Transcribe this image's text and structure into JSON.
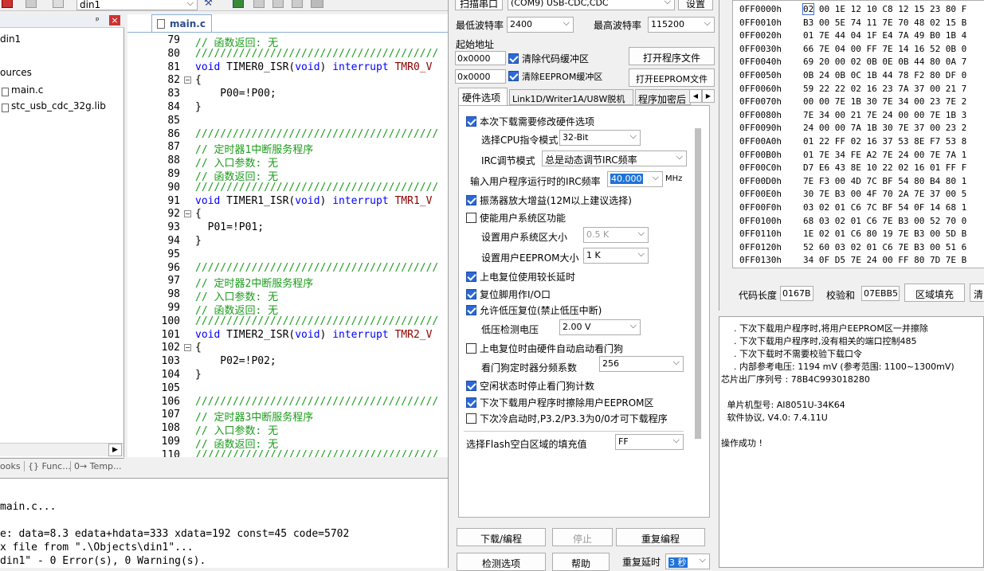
{
  "toolbar": {
    "target_select": "din1"
  },
  "project": {
    "header_pin": "ᵖ",
    "header_close": "×",
    "items": [
      {
        "label": "din1"
      },
      {
        "label": "ources"
      },
      {
        "label": "main.c"
      },
      {
        "label": "stc_usb_cdc_32g.lib"
      }
    ],
    "bottom_tabs": [
      {
        "label": "ooks"
      },
      {
        "label": "{} Func..."
      },
      {
        "label": "0→ Temp..."
      }
    ]
  },
  "editor": {
    "tab": "main.c",
    "lines": [
      {
        "n": "79",
        "t": "// 函数返回: 无",
        "c": "cm"
      },
      {
        "n": "80",
        "t": "///////////////////////////////////////",
        "c": "cm"
      },
      {
        "n": "81",
        "t": "void TIMER0_ISR(void) interrupt TMR0_V",
        "c": "fn",
        "f": "-"
      },
      {
        "n": "82",
        "t": "{",
        "c": "",
        "f": "⊟"
      },
      {
        "n": "83",
        "t": "    P00=!P00;",
        "c": ""
      },
      {
        "n": "84",
        "t": "}",
        "c": ""
      },
      {
        "n": "85",
        "t": "",
        "c": ""
      },
      {
        "n": "86",
        "t": "///////////////////////////////////////",
        "c": "cm"
      },
      {
        "n": "87",
        "t": "// 定时器1中断服务程序",
        "c": "cm"
      },
      {
        "n": "88",
        "t": "// 入口参数: 无",
        "c": "cm"
      },
      {
        "n": "89",
        "t": "// 函数返回: 无",
        "c": "cm"
      },
      {
        "n": "90",
        "t": "///////////////////////////////////////",
        "c": "cm"
      },
      {
        "n": "91",
        "t": "void TIMER1_ISR(void) interrupt TMR1_V",
        "c": "fn"
      },
      {
        "n": "92",
        "t": "{",
        "c": "",
        "f": "⊟"
      },
      {
        "n": "93",
        "t": "  P01=!P01;",
        "c": ""
      },
      {
        "n": "94",
        "t": "}",
        "c": ""
      },
      {
        "n": "95",
        "t": "",
        "c": ""
      },
      {
        "n": "96",
        "t": "///////////////////////////////////////",
        "c": "cm"
      },
      {
        "n": "97",
        "t": "// 定时器2中断服务程序",
        "c": "cm"
      },
      {
        "n": "98",
        "t": "// 入口参数: 无",
        "c": "cm"
      },
      {
        "n": "99",
        "t": "// 函数返回: 无",
        "c": "cm"
      },
      {
        "n": "100",
        "t": "///////////////////////////////////////",
        "c": "cm"
      },
      {
        "n": "101",
        "t": "void TIMER2_ISR(void) interrupt TMR2_V",
        "c": "fn"
      },
      {
        "n": "102",
        "t": "{",
        "c": "",
        "f": "⊟"
      },
      {
        "n": "103",
        "t": "    P02=!P02;",
        "c": ""
      },
      {
        "n": "104",
        "t": "}",
        "c": ""
      },
      {
        "n": "105",
        "t": "",
        "c": ""
      },
      {
        "n": "106",
        "t": "///////////////////////////////////////",
        "c": "cm"
      },
      {
        "n": "107",
        "t": "// 定时器3中断服务程序",
        "c": "cm"
      },
      {
        "n": "108",
        "t": "// 入口参数: 无",
        "c": "cm"
      },
      {
        "n": "109",
        "t": "// 函数返回: 无",
        "c": "cm"
      },
      {
        "n": "110",
        "t": "///////////////////////////////////////",
        "c": "cm"
      }
    ]
  },
  "output": {
    "lines": [
      "main.c...",
      "",
      "e: data=8.3 edata+hdata=333 xdata=192 const=45 code=5702",
      "x file from \".\\Objects\\din1\"...",
      "din1\" - 0 Error(s), 0 Warning(s)."
    ]
  },
  "isp": {
    "scan_port": "扫描串口",
    "port_value": "(COM9) USB-CDC,CDC",
    "settings_btn": "设置",
    "min_baud_label": "最低波特率",
    "min_baud": "2400",
    "max_baud_label": "最高波特率",
    "max_baud": "115200",
    "start_addr_label": "起始地址",
    "addr1": "0x0000",
    "addr2": "0x0000",
    "clear_code": "清除代码缓冲区",
    "clear_eeprom": "清除EEPROM缓冲区",
    "open_prog": "打开程序文件",
    "open_eeprom": "打开EEPROM文件",
    "tabs": [
      "硬件选项",
      "Link1D/Writer1A/U8W脱机",
      "程序加密后"
    ],
    "opts": {
      "modify_hw": "本次下载需要修改硬件选项",
      "cpu_mode_label": "选择CPU指令模式",
      "cpu_mode": "32-Bit",
      "irc_mode_label": "IRC调节模式",
      "irc_mode": "总是动态调节IRC频率",
      "irc_freq_label": "输入用户程序运行时的IRC频率",
      "irc_freq": "40.000",
      "irc_unit": "MHz",
      "osc_gain": "振荡器放大增益(12M以上建议选择)",
      "user_sys": "使能用户系统区功能",
      "user_sys_size_label": "设置用户系统区大小",
      "user_sys_size": "0.5 K",
      "eeprom_size_label": "设置用户EEPROM大小",
      "eeprom_size": "1   K",
      "long_delay": "上电复位使用较长延时",
      "reset_io": "复位脚用作I/O口",
      "lvr": "允许低压复位(禁止低压中断)",
      "lv_label": "低压检测电压",
      "lv_value": "2.00 V",
      "wdt_auto": "上电复位时由硬件自动启动看门狗",
      "wdt_div_label": "看门狗定时器分频系数",
      "wdt_div": "256",
      "idle_wdt": "空闲状态时停止看门狗计数",
      "erase_eeprom": "下次下载用户程序时擦除用户EEPROM区",
      "cold_boot": "下次冷启动时,P3.2/P3.3为0/0才可下载程序",
      "fill_label": "选择Flash空白区域的填充值",
      "fill_value": "FF"
    },
    "download": "下载/编程",
    "stop": "停止",
    "repeat": "重复编程",
    "detect": "检测选项",
    "help": "帮助",
    "repeat_delay_label": "重复延时",
    "repeat_delay": "3 秒"
  },
  "hex": {
    "rows": [
      {
        "addr": "0FF0000h",
        "bytes": "02 00 1E 12 10 C8 12 15 23 80 F"
      },
      {
        "addr": "0FF0010h",
        "bytes": "B3 00 5E 74 11 7E 70 48 02 15 B"
      },
      {
        "addr": "0FF0020h",
        "bytes": "01 7E 44 04 1F E4 7A 49 B0 1B 4"
      },
      {
        "addr": "0FF0030h",
        "bytes": "66 7E 04 00 FF 7E 14 16 52 0B 0"
      },
      {
        "addr": "0FF0040h",
        "bytes": "69 20 00 02 0B 0E 0B 44 80 0A 7"
      },
      {
        "addr": "0FF0050h",
        "bytes": "0B 24 0B 0C 1B 44 78 F2 80 DF 0"
      },
      {
        "addr": "0FF0060h",
        "bytes": "59 22 22 02 16 23 7A 37 00 21 7"
      },
      {
        "addr": "0FF0070h",
        "bytes": "00 00 7E 1B 30 7E 34 00 23 7E 2"
      },
      {
        "addr": "0FF0080h",
        "bytes": "7E 34 00 21 7E 24 00 00 7E 1B 3"
      },
      {
        "addr": "0FF0090h",
        "bytes": "24 00 00 7A 1B 30 7E 37 00 23 2"
      },
      {
        "addr": "0FF00A0h",
        "bytes": "01 22 FF 02 16 37 53 8E F7 53 8"
      },
      {
        "addr": "0FF00B0h",
        "bytes": "01 7E 34 FE A2 7E 24 00 7E 7A 1"
      },
      {
        "addr": "0FF00C0h",
        "bytes": "D7 E6 43 8E 10 22 02 16 01 FF F"
      },
      {
        "addr": "0FF00D0h",
        "bytes": "7E F3 00 4D 7C BF 54 80 B4 80 1"
      },
      {
        "addr": "0FF00E0h",
        "bytes": "30 7E B3 00 4F 70 2A 7E 37 00 5"
      },
      {
        "addr": "0FF00F0h",
        "bytes": "03 02 01 C6 7C BF 54 0F 14 68 1"
      },
      {
        "addr": "0FF0100h",
        "bytes": "68 03 02 01 C6 7E B3 00 52 70 0"
      },
      {
        "addr": "0FF0110h",
        "bytes": "1E 02 01 C6 80 19 7E B3 00 5D B"
      },
      {
        "addr": "0FF0120h",
        "bytes": "52 60 03 02 01 C6 7E B3 00 51 6"
      },
      {
        "addr": "0FF0130h",
        "bytes": "34 0F D5 7E 24 00 FF 80 7D 7E B"
      }
    ],
    "code_len_label": "代码长度",
    "code_len": "0167B",
    "checksum_label": "校验和",
    "checksum": "07EBB5",
    "fill_btn": "区域填充",
    "clear_btn": "清"
  },
  "log": {
    "lines": [
      ". 下次下载用户程序时,将用户EEPROM区一并擦除",
      ". 下次下载用户程序时,没有相关的端口控制485",
      ". 下次下载时不需要校验下载口令",
      ". 内部参考电压: 1194 mV (参考范围: 1100~1300mV)",
      "芯片出厂序列号 : 78B4C993018280",
      "",
      " 单片机型号: AI8051U-34K64",
      " 软件协议, V4.0: 7.4.11U",
      "",
      "操作成功 !"
    ]
  }
}
